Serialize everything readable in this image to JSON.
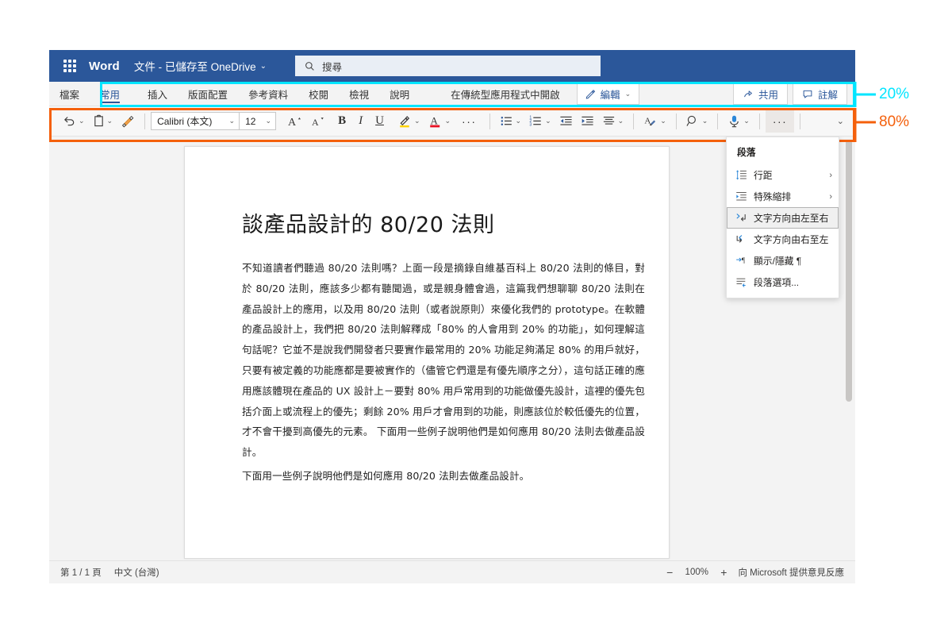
{
  "titlebar": {
    "app_name": "Word",
    "doc_title": "文件 - 已儲存至 OneDrive",
    "doc_title_caret": "⌄",
    "waffle_name": "app-launcher",
    "search_placeholder": "搜尋"
  },
  "tabs": {
    "items": [
      {
        "label": "檔案",
        "active": false
      },
      {
        "label": "常用",
        "active": true
      },
      {
        "label": "插入",
        "active": false
      },
      {
        "label": "版面配置",
        "active": false
      },
      {
        "label": "參考資料",
        "active": false
      },
      {
        "label": "校閱",
        "active": false
      },
      {
        "label": "檢視",
        "active": false
      },
      {
        "label": "說明",
        "active": false
      }
    ],
    "open_in_desktop": "在傳統型應用程式中開啟",
    "edit_label": "編輯",
    "edit_caret": "⌄",
    "share_label": "共用",
    "comments_label": "註解"
  },
  "toolbar": {
    "undo_caret": "⌄",
    "paste_caret": "⌄",
    "format_painter_name": "format-painter",
    "font_name": "Calibri (本文)",
    "font_caret": "⌄",
    "font_size": "12",
    "size_caret": "⌄",
    "grow_font": "A",
    "shrink_font": "A",
    "bold": "B",
    "italic": "I",
    "underline": "U",
    "highlight_caret": "⌄",
    "fontcolor_letter": "A",
    "fontcolor_caret": "⌄",
    "more_font": "···",
    "bullets_caret": "⌄",
    "numbering_caret": "⌄",
    "align_caret": "⌄",
    "styles_caret": "⌄",
    "find_caret": "⌄",
    "dictate_caret": "⌄",
    "more_commands": "···",
    "expand_caret": "⌄"
  },
  "context_menu": {
    "title": "段落",
    "items": [
      {
        "label": "行距",
        "icon": "line-spacing-icon",
        "submenu": "›",
        "highlight": false
      },
      {
        "label": "特殊縮排",
        "icon": "indent-icon",
        "submenu": "›",
        "highlight": false
      },
      {
        "label": "文字方向由左至右",
        "icon": "ltr-icon",
        "submenu": "",
        "highlight": true
      },
      {
        "label": "文字方向由右至左",
        "icon": "rtl-icon",
        "submenu": "",
        "highlight": false
      },
      {
        "label": "顯示/隱藏 ¶",
        "icon": "show-hide-icon",
        "submenu": "",
        "highlight": false
      },
      {
        "label": "段落選項...",
        "icon": "paragraph-options-icon",
        "submenu": "",
        "highlight": false
      }
    ]
  },
  "document": {
    "heading": "談產品設計的 80/20 法則",
    "paragraph1": "不知道讀者們聽過 80/20 法則嗎？上面一段是摘錄自維基百科上 80/20 法則的條目，對於 80/20 法則，應該多少都有聽聞過，或是親身體會過，這篇我們想聊聊 80/20 法則在產品設計上的應用，以及用 80/20 法則（或者說原則）來優化我們的 prototype。在軟體的產品設計上，我們把 80/20 法則解釋成「80% 的人會用到 20% 的功能」，如何理解這句話呢？它並不是說我們開發者只要實作最常用的 20% 功能足夠滿足 80% 的用戶就好，只要有被定義的功能應都是要被實作的（儘管它們還是有優先順序之分），這句話正確的應用應該體現在產品的 UX 設計上－要對 80% 用戶常用到的功能做優先設計，這裡的優先包括介面上或流程上的優先；剩餘 20% 用戶才會用到的功能，則應該位於較低優先的位置，才不會干擾到高優先的元素。 下面用一些例子說明他們是如何應用 80/20 法則去做產品設計。",
    "paragraph2": "下面用一些例子說明他們是如何應用 80/20 法則去做產品設計。"
  },
  "statusbar": {
    "page_info": "第 1 / 1 頁",
    "language": "中文 (台灣)",
    "zoom_out": "−",
    "zoom_value": "100%",
    "zoom_in": "+",
    "feedback": "向 Microsoft 提供意見反應"
  },
  "annotations": {
    "cyan_label": "20%",
    "cyan_color": "#00e5ff",
    "orange_label": "80%",
    "orange_color": "#f4600c"
  }
}
